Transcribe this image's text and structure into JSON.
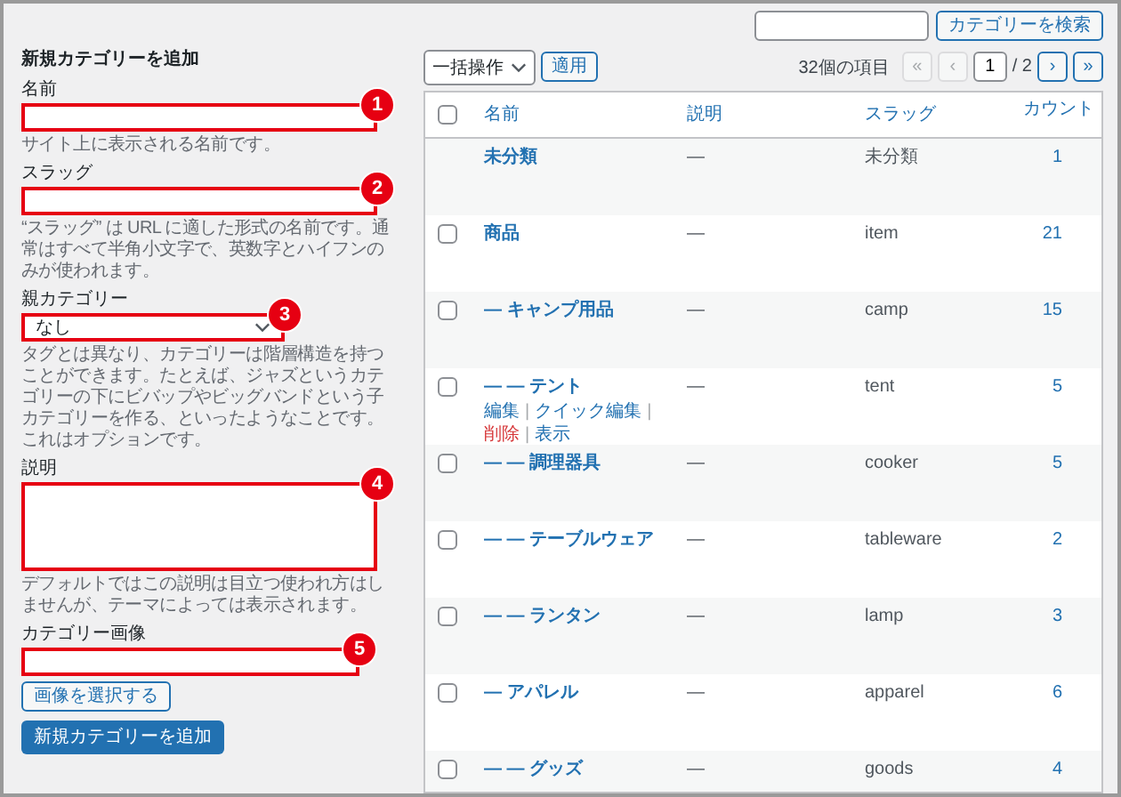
{
  "form": {
    "title": "新規カテゴリーを追加",
    "fields": [
      {
        "kind": "text",
        "label": "名前",
        "marker": "1",
        "hint": "サイト上に表示される名前です。"
      },
      {
        "kind": "text",
        "label": "スラッグ",
        "marker": "2",
        "hint": "“スラッグ” は URL に適した形式の名前です。通常はすべて半角小文字で、英数字とハイフンのみが使われます。"
      },
      {
        "kind": "select",
        "label": "親カテゴリー",
        "marker": "3",
        "value": "なし",
        "hint": "タグとは異なり、カテゴリーは階層構造を持つことができます。たとえば、ジャズというカテゴリーの下にビバップやビッグバンドという子カテゴリーを作る、といったようなことです。これはオプションです。"
      },
      {
        "kind": "textarea",
        "label": "説明",
        "marker": "4",
        "hint": "デフォルトではこの説明は目立つ使われ方はしませんが、テーマによっては表示されます。"
      },
      {
        "kind": "image",
        "label": "カテゴリー画像",
        "marker": "5",
        "button": "画像を選択する"
      }
    ],
    "submit": "新規カテゴリーを追加"
  },
  "search": {
    "button": "カテゴリーを検索"
  },
  "toolbar": {
    "bulk_action": "一括操作",
    "apply": "適用",
    "count": "32個の項目",
    "pages": [
      {
        "label": "«",
        "disabled": true
      },
      {
        "label": "‹",
        "disabled": true
      }
    ],
    "current_page": "1",
    "total": "/ 2",
    "next_pages": [
      {
        "label": "›",
        "disabled": false
      },
      {
        "label": "»",
        "disabled": false
      }
    ]
  },
  "table": {
    "select_all_checked": false,
    "columns": [
      "名前",
      "説明",
      "スラッグ",
      "カウント"
    ],
    "rows": [
      {
        "name": "未分類",
        "description": "—",
        "slug": "未分類",
        "count": "1",
        "selectable": false
      },
      {
        "name": "商品",
        "description": "—",
        "slug": "item",
        "count": "21",
        "selectable": true,
        "checked": false
      },
      {
        "name": "— キャンプ用品",
        "description": "—",
        "slug": "camp",
        "count": "15",
        "selectable": true,
        "checked": false
      },
      {
        "name": "— — テント",
        "description": "—",
        "slug": "tent",
        "count": "5",
        "selectable": true,
        "checked": false,
        "actions": [
          {
            "label": "編集",
            "kind": "link"
          },
          {
            "label": "|",
            "kind": "sep"
          },
          {
            "label": "クイック編集",
            "kind": "link"
          },
          {
            "label": "|",
            "kind": "sep"
          },
          {
            "label": "削除",
            "kind": "delete"
          },
          {
            "label": "|",
            "kind": "sep"
          },
          {
            "label": "表示",
            "kind": "link"
          }
        ]
      },
      {
        "name": "— — 調理器具",
        "description": "—",
        "slug": "cooker",
        "count": "5",
        "selectable": true,
        "checked": false
      },
      {
        "name": "— — テーブルウェア",
        "description": "—",
        "slug": "tableware",
        "count": "2",
        "selectable": true,
        "checked": false
      },
      {
        "name": "— — ランタン",
        "description": "—",
        "slug": "lamp",
        "count": "3",
        "selectable": true,
        "checked": false
      },
      {
        "name": "— アパレル",
        "description": "—",
        "slug": "apparel",
        "count": "6",
        "selectable": true,
        "checked": false
      },
      {
        "name": "— — グッズ",
        "description": "—",
        "slug": "goods",
        "count": "4",
        "selectable": true,
        "checked": false
      }
    ]
  }
}
